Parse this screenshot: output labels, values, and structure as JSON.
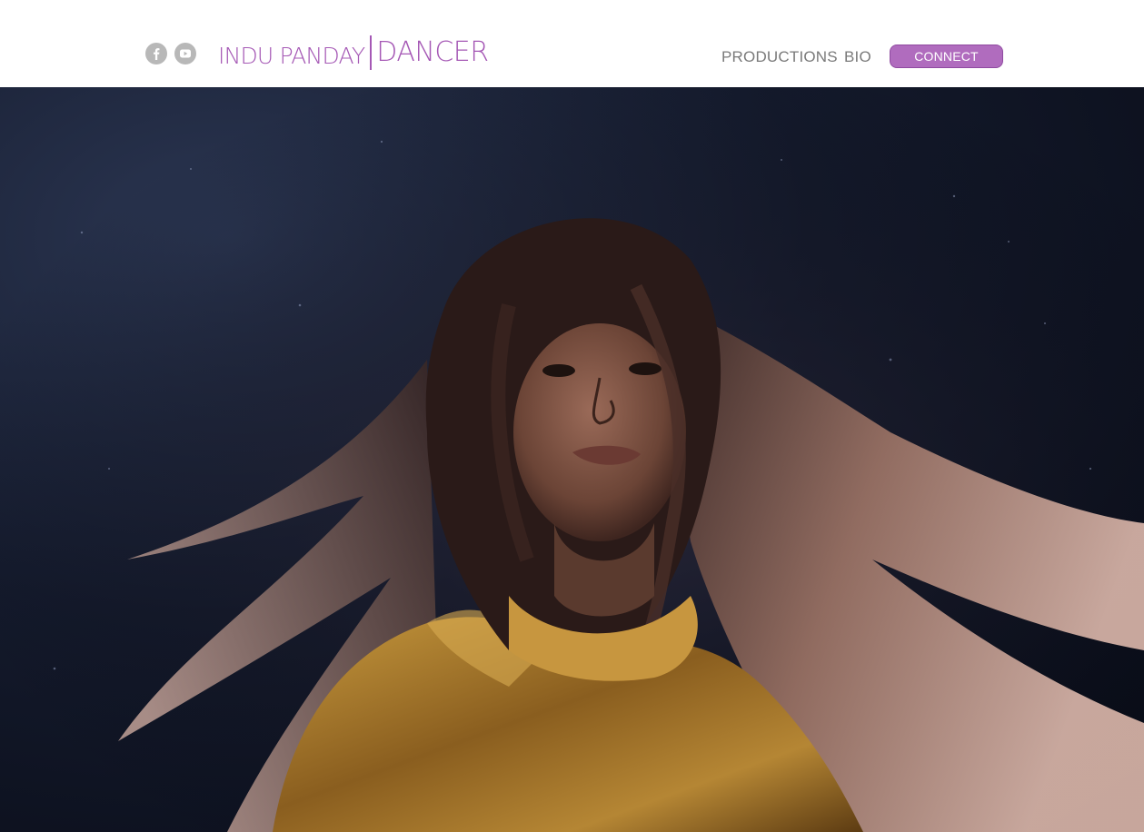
{
  "header": {
    "social": [
      {
        "name": "facebook",
        "icon": "facebook-icon"
      },
      {
        "name": "youtube",
        "icon": "youtube-icon"
      }
    ],
    "logo": {
      "left_text": "INDU PANDAY",
      "right_text": "DANCER",
      "color": "#a558b5"
    },
    "nav": {
      "productions": "PRODUCTIONS",
      "bio": "BIO",
      "connect": "CONNECT"
    },
    "accent_color": "#b06cbe"
  },
  "hero": {
    "image_description_icon": "dancer-photo"
  }
}
